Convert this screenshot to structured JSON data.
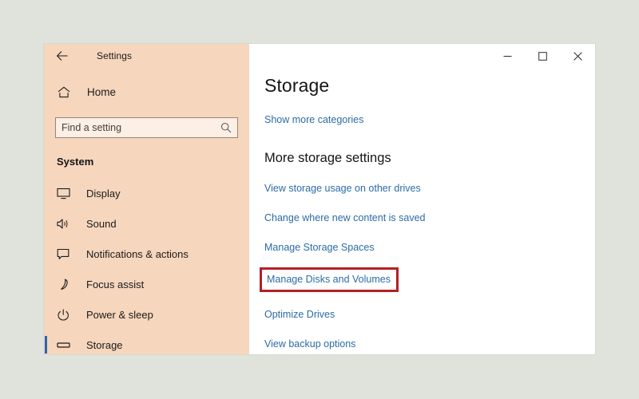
{
  "window": {
    "titlebar_title": "Settings",
    "back_icon": "back-arrow-icon",
    "controls": {
      "minimize": "─",
      "maximize": "☐",
      "close": "✕"
    }
  },
  "sidebar": {
    "home": {
      "label": "Home",
      "icon": "home-icon"
    },
    "search": {
      "value": "",
      "placeholder": "Find a setting",
      "icon": "search-icon"
    },
    "section_title": "System",
    "items": [
      {
        "label": "Display",
        "icon": "monitor-icon",
        "selected": false
      },
      {
        "label": "Sound",
        "icon": "speaker-icon",
        "selected": false
      },
      {
        "label": "Notifications & actions",
        "icon": "notification-icon",
        "selected": false
      },
      {
        "label": "Focus assist",
        "icon": "moon-icon",
        "selected": false
      },
      {
        "label": "Power & sleep",
        "icon": "power-icon",
        "selected": false
      },
      {
        "label": "Storage",
        "icon": "drive-icon",
        "selected": true
      }
    ]
  },
  "main": {
    "title": "Storage",
    "show_more_categories": "Show more categories",
    "sub_heading": "More storage settings",
    "links": [
      {
        "label": "View storage usage on other drives",
        "highlighted": false
      },
      {
        "label": "Change where new content is saved",
        "highlighted": false
      },
      {
        "label": "Manage Storage Spaces",
        "highlighted": false
      },
      {
        "label": "Manage Disks and Volumes",
        "highlighted": true
      },
      {
        "label": "Optimize Drives",
        "highlighted": false
      },
      {
        "label": "View backup options",
        "highlighted": false
      }
    ]
  },
  "colors": {
    "sidebar_bg": "#F6D6BD",
    "page_bg": "#DFE3DB",
    "link": "#2C6BA5",
    "accent": "#2A63B5",
    "highlight_border": "#B32025"
  }
}
